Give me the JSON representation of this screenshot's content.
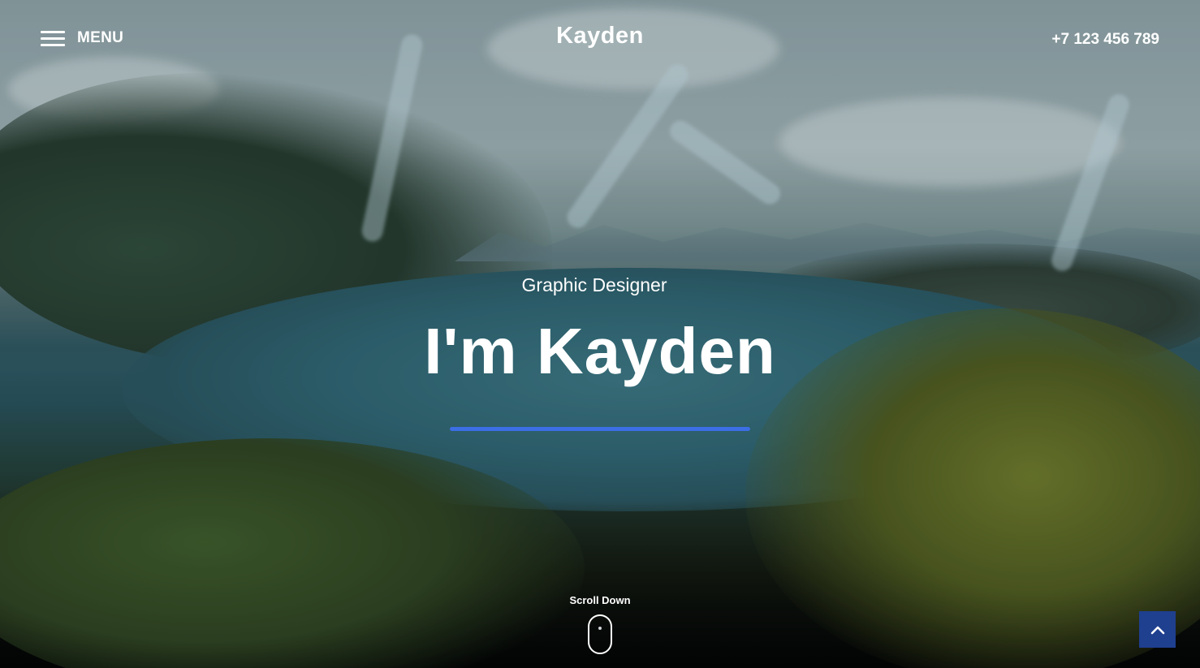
{
  "header": {
    "menu_label": "MENU",
    "logo": "Kayden",
    "phone": "+7 123 456 789"
  },
  "hero": {
    "subtitle": "Graphic Designer",
    "headline": "I'm Kayden",
    "scroll_label": "Scroll Down"
  },
  "icons": {
    "menu": "hamburger-icon",
    "scroll": "mouse-icon",
    "back_to_top": "chevron-up-icon"
  },
  "colors": {
    "accent": "#3c6ee6",
    "back_to_top_bg": "#1f3f8f",
    "text": "#ffffff"
  }
}
